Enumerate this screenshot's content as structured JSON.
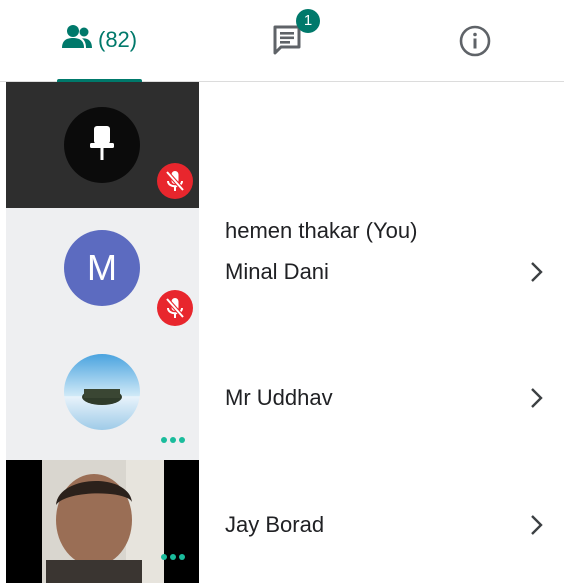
{
  "tabs": {
    "people_count": "(82)",
    "chat_badge": "1",
    "accent_color": "#00796b",
    "icons": [
      "people-icon",
      "chat-icon",
      "info-icon"
    ]
  },
  "participants": [
    {
      "name": "hemen thakar (You)",
      "avatar": "pin-icon",
      "muted": true,
      "tile_color": "#2e2e2e"
    },
    {
      "name": "Minal Dani",
      "avatar_letter": "M",
      "avatar_color": "#5c6bc0",
      "muted": true,
      "tile_color": "#eeeff1"
    },
    {
      "name": "Mr Uddhav",
      "avatar": "landscape-photo",
      "speaking_indicator": true,
      "tile_color": "#eeeff1"
    },
    {
      "name": "Jay Borad",
      "avatar": "video-feed",
      "speaking_indicator": true,
      "tile_color": "#000000"
    }
  ],
  "colors": {
    "mute_red": "#e8262d",
    "dots_teal": "#1abc9c"
  }
}
